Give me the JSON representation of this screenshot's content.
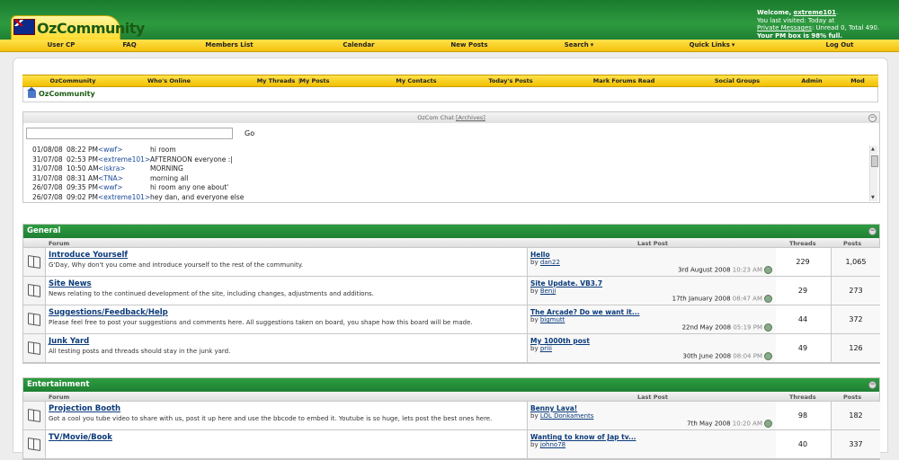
{
  "header": {
    "logo_text": "OzCommunity",
    "welcome_prefix": "Welcome,",
    "username": "extreme101",
    "last_visited": "You last visited: Today at",
    "private_messages_label": "Private Messages",
    "pm_counts": ": Unread 0, Total 490.",
    "pm_full": "Your PM box is 98% full."
  },
  "topnav": [
    "User CP",
    "FAQ",
    "Members List",
    "Calendar",
    "New Posts",
    "Search",
    "Quick Links",
    "Log Out"
  ],
  "innernav": [
    "OzCommunity",
    "Who's Online",
    "My Threads",
    "|",
    "My Posts",
    "My Contacts",
    "Today's Posts",
    "Mark Forums Read",
    "Social Groups",
    "Admin",
    "Mod"
  ],
  "breadcrumb": "OzCommunity",
  "chat": {
    "title": "OzCom Chat",
    "archives": "[Archives]",
    "input_value": "",
    "go_label": "Go",
    "messages": [
      {
        "date": "01/08/08",
        "time": "08:22 PM",
        "user": "<wwf>",
        "text": "hi room"
      },
      {
        "date": "31/07/08",
        "time": "02:53 PM",
        "user": "<extreme101>",
        "text": "AFTERNOON everyone :|"
      },
      {
        "date": "31/07/08",
        "time": "10:50 AM",
        "user": "<iskra>",
        "text": "MORNING"
      },
      {
        "date": "31/07/08",
        "time": "08:31 AM",
        "user": "<TNA>",
        "text": "morning all"
      },
      {
        "date": "26/07/08",
        "time": "09:35 PM",
        "user": "<wwf>",
        "text": "hi room any one about'"
      },
      {
        "date": "26/07/08",
        "time": "09:02 PM",
        "user": "<extreme101>",
        "text": "hey dan, and everyone else"
      }
    ]
  },
  "sections": [
    {
      "title": "General",
      "col_forum": "Forum",
      "col_last": "Last Post",
      "col_threads": "Threads",
      "col_posts": "Posts",
      "forums": [
        {
          "name": "Introduce Yourself",
          "desc": "G'Day, Why don't you come and introduce yourself to the rest of the community.",
          "last_title": "Hello",
          "last_by": "by",
          "last_user": "dan22",
          "last_date": "3rd August 2008",
          "last_time": "10:23 AM",
          "threads": "229",
          "posts": "1,065"
        },
        {
          "name": "Site News",
          "desc": "News relating to the continued development of the site, including changes, adjustments and additions.",
          "last_title": "Site Update. VB3.7",
          "last_by": "by",
          "last_user": "Benji",
          "last_date": "17th January 2008",
          "last_time": "08:47 AM",
          "threads": "29",
          "posts": "273"
        },
        {
          "name": "Suggestions/Feedback/Help",
          "desc": "Please feel free to post your suggestions and comments here. All suggestions taken on board, you shape how this board will be made.",
          "last_title": "The Arcade? Do we want it...",
          "last_by": "by",
          "last_user": "bigmutt",
          "last_date": "22nd May 2008",
          "last_time": "05:19 PM",
          "threads": "44",
          "posts": "372"
        },
        {
          "name": "Junk Yard",
          "desc": "All testing posts and threads should stay in the junk yard.",
          "last_title": "My 1000th post",
          "last_by": "by",
          "last_user": "priii",
          "last_date": "30th June 2008",
          "last_time": "08:04 PM",
          "threads": "49",
          "posts": "126"
        }
      ]
    },
    {
      "title": "Entertainment",
      "col_forum": "Forum",
      "col_last": "Last Post",
      "col_threads": "Threads",
      "col_posts": "Posts",
      "forums": [
        {
          "name": "Projection Booth",
          "desc": "Got a cool you tube video to share with us, post it up here and use the bbcode to embed it. Youtube is so huge, lets post the best ones here.",
          "last_title": "Benny Lava!",
          "last_by": "by",
          "last_user": "LOL Donkaments",
          "last_date": "7th May 2008",
          "last_time": "10:20 AM",
          "threads": "98",
          "posts": "182"
        },
        {
          "name": "TV/Movie/Book",
          "desc": "",
          "last_title": "Wanting to know of Jap tv...",
          "last_by": "by",
          "last_user": "johno78",
          "last_date": "",
          "last_time": "",
          "threads": "40",
          "posts": "337"
        }
      ]
    }
  ]
}
